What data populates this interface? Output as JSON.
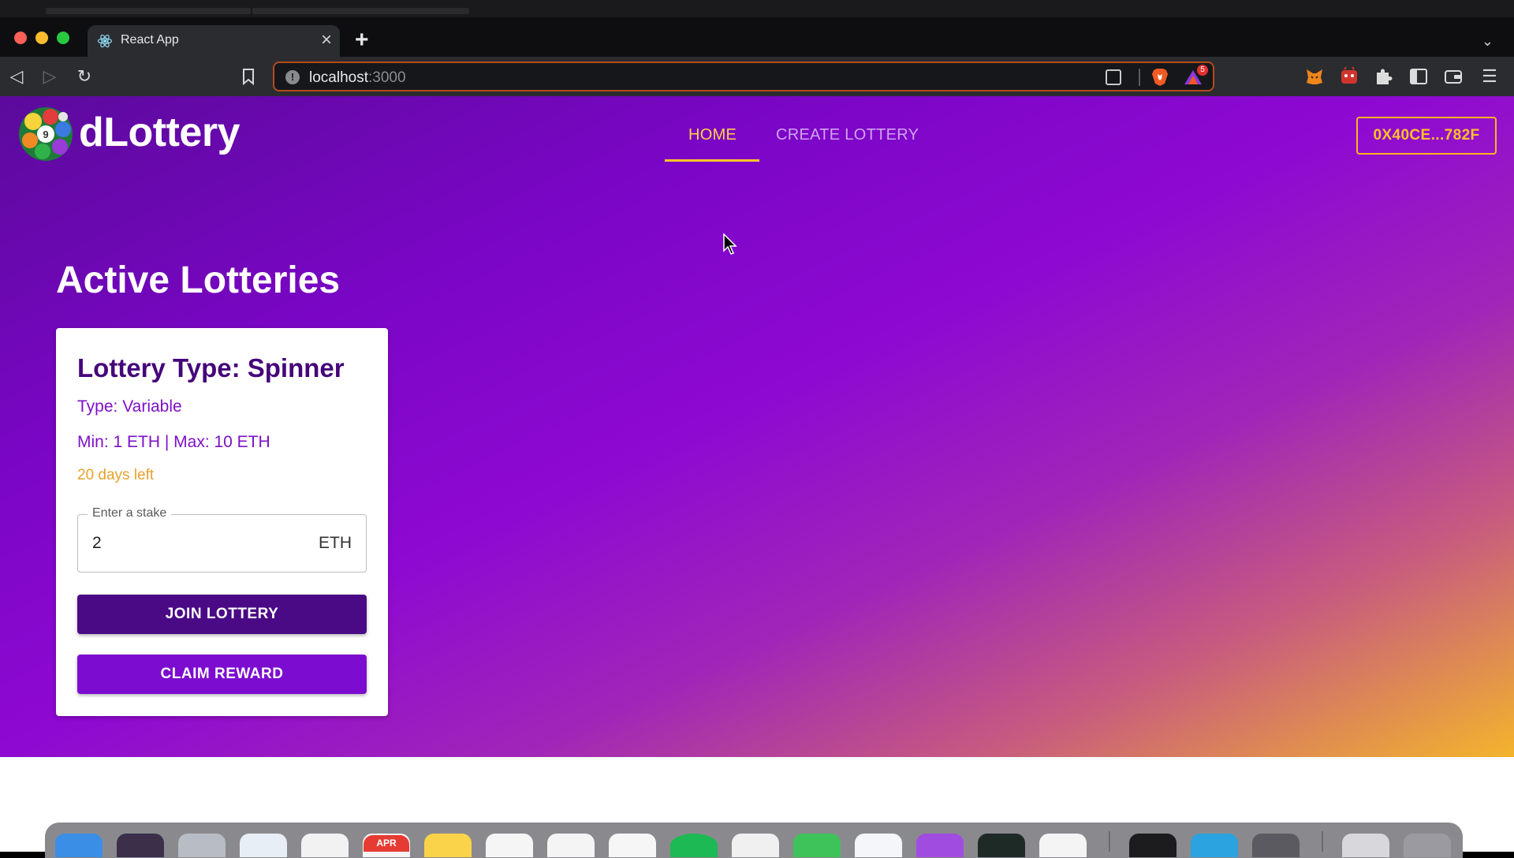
{
  "browser": {
    "tab_title": "React App",
    "url_host": "localhost",
    "url_port": ":3000",
    "rewards_badge": "5",
    "colors": {
      "accent": "#b44b1c",
      "chrome": "#2b2c30"
    }
  },
  "app": {
    "brand": "dLottery",
    "nav": {
      "home": "HOME",
      "create": "CREATE LOTTERY"
    },
    "wallet_address": "0X40CE...782F",
    "heading": "Active Lotteries",
    "colors": {
      "primary": "#4a0a86",
      "secondary": "#7c0cd0",
      "highlight": "#ffc629"
    }
  },
  "lottery_card": {
    "title": "Lottery Type: Spinner",
    "type_line": "Type: Variable",
    "range_line": "Min: 1 ETH | Max: 10 ETH",
    "days_left": "20 days left",
    "stake_label": "Enter a stake",
    "stake_value": "2",
    "stake_unit": "ETH",
    "join_label": "JOIN LOTTERY",
    "claim_label": "CLAIM REWARD"
  },
  "dock": {
    "calendar_month": "APR"
  }
}
